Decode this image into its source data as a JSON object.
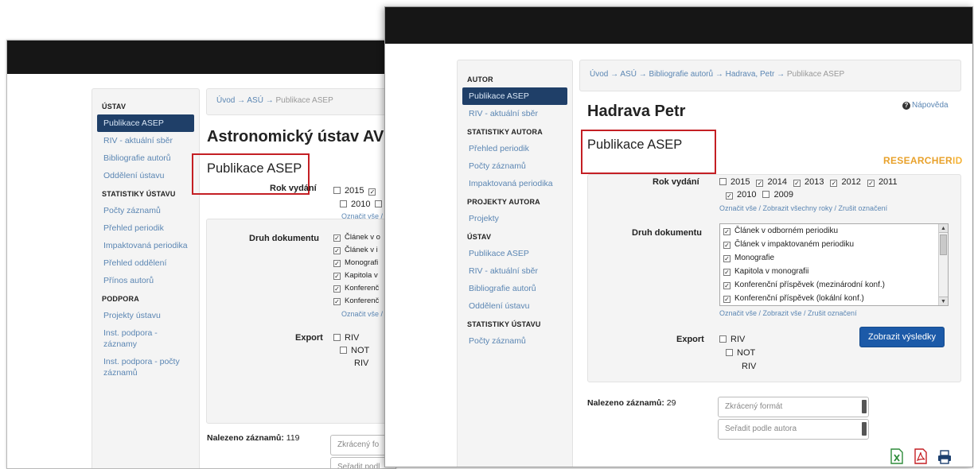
{
  "back_window": {
    "sidebar": {
      "heading_ustav": "ÚSTAV",
      "items_ustav": [
        "Publikace ASEP",
        "RIV - aktuální sběr",
        "Bibliografie autorů",
        "Oddělení ústavu"
      ],
      "heading_stats": "STATISTIKY ÚSTAVU",
      "items_stats": [
        "Počty záznamů",
        "Přehled periodik",
        "Impaktovaná periodika",
        "Přehled oddělení",
        "Přínos autorů"
      ],
      "heading_podpora": "PODPORA",
      "items_podpora": [
        "Projekty ústavu",
        "Inst. podpora - záznamy",
        "Inst. podpora - počty záznamů"
      ]
    },
    "breadcrumb": {
      "path": "Úvod → ASÚ → ",
      "current": "Publikace ASEP"
    },
    "page_title": "Astronomický ústav AV",
    "section_title": "Publikace ASEP",
    "form": {
      "rok_label": "Rok vydání",
      "years_row1": "2015",
      "years_row2": "2010",
      "years_links": "Označit vše / Zr",
      "druh_label": "Druh dokumentu",
      "doc_types": [
        "Článek v o",
        "Článek v i",
        "Monografi",
        "Kapitola v",
        "Konferenč",
        "Konferenč"
      ],
      "doc_links": "Označit vše / Zo",
      "export_label": "Export",
      "export_riv": "RIV",
      "export_not": "NOT",
      "export_not2": "RIV"
    },
    "results": {
      "label": "Nalezeno záznamů:",
      "count": "119"
    },
    "select_format": "Zkrácený fo",
    "select_sort": "Seřadit podl"
  },
  "front_window": {
    "sidebar": {
      "heading_autor": "AUTOR",
      "items_autor": [
        "Publikace ASEP",
        "RIV - aktuální sběr"
      ],
      "heading_stats_autor": "STATISTIKY AUTORA",
      "items_stats_autor": [
        "Přehled periodik",
        "Počty záznamů",
        "Impaktovaná periodika"
      ],
      "heading_projekty": "PROJEKTY AUTORA",
      "items_projekty": [
        "Projekty"
      ],
      "heading_ustav": "ÚSTAV",
      "items_ustav": [
        "Publikace ASEP",
        "RIV - aktuální sběr",
        "Bibliografie autorů",
        "Oddělení ústavu"
      ],
      "heading_stats_ustav": "STATISTIKY ÚSTAVU",
      "items_stats_ustav": [
        "Počty záznamů"
      ]
    },
    "breadcrumb": {
      "path": "Úvod → ASÚ → Bibliografie autorů → Hadrava, Petr → ",
      "current": "Publikace ASEP"
    },
    "page_title": "Hadrava Petr",
    "help_label": "Nápověda",
    "section_title": "Publikace ASEP",
    "researcher_label": "RESEARCHER",
    "researcher_id": "ID",
    "form": {
      "rok_label": "Rok vydání",
      "years": [
        {
          "year": "2015",
          "checked": false
        },
        {
          "year": "2014",
          "checked": true
        },
        {
          "year": "2013",
          "checked": true
        },
        {
          "year": "2012",
          "checked": true
        },
        {
          "year": "2011",
          "checked": true
        },
        {
          "year": "2010",
          "checked": true
        },
        {
          "year": "2009",
          "checked": false
        }
      ],
      "years_links": "Označit vše / Zobrazit všechny roky / Zrušit označení",
      "druh_label": "Druh dokumentu",
      "doc_types": [
        "Článek v odborném periodiku",
        "Článek v impaktovaném periodiku",
        "Monografie",
        "Kapitola v monografii",
        "Konferenční příspěvek (mezinárodní konf.)",
        "Konferenční příspěvek (lokální konf.)"
      ],
      "doc_links": "Označit vše / Zobrazit vše / Zrušit označení",
      "export_label": "Export",
      "export_riv": "RIV",
      "export_not": "NOT",
      "export_not2": "RIV",
      "submit_label": "Zobrazit výsledky"
    },
    "results": {
      "label": "Nalezeno záznamů:",
      "count": "29"
    },
    "select_format": "Zkrácený formát",
    "select_sort": "Seřadit podle autora"
  }
}
